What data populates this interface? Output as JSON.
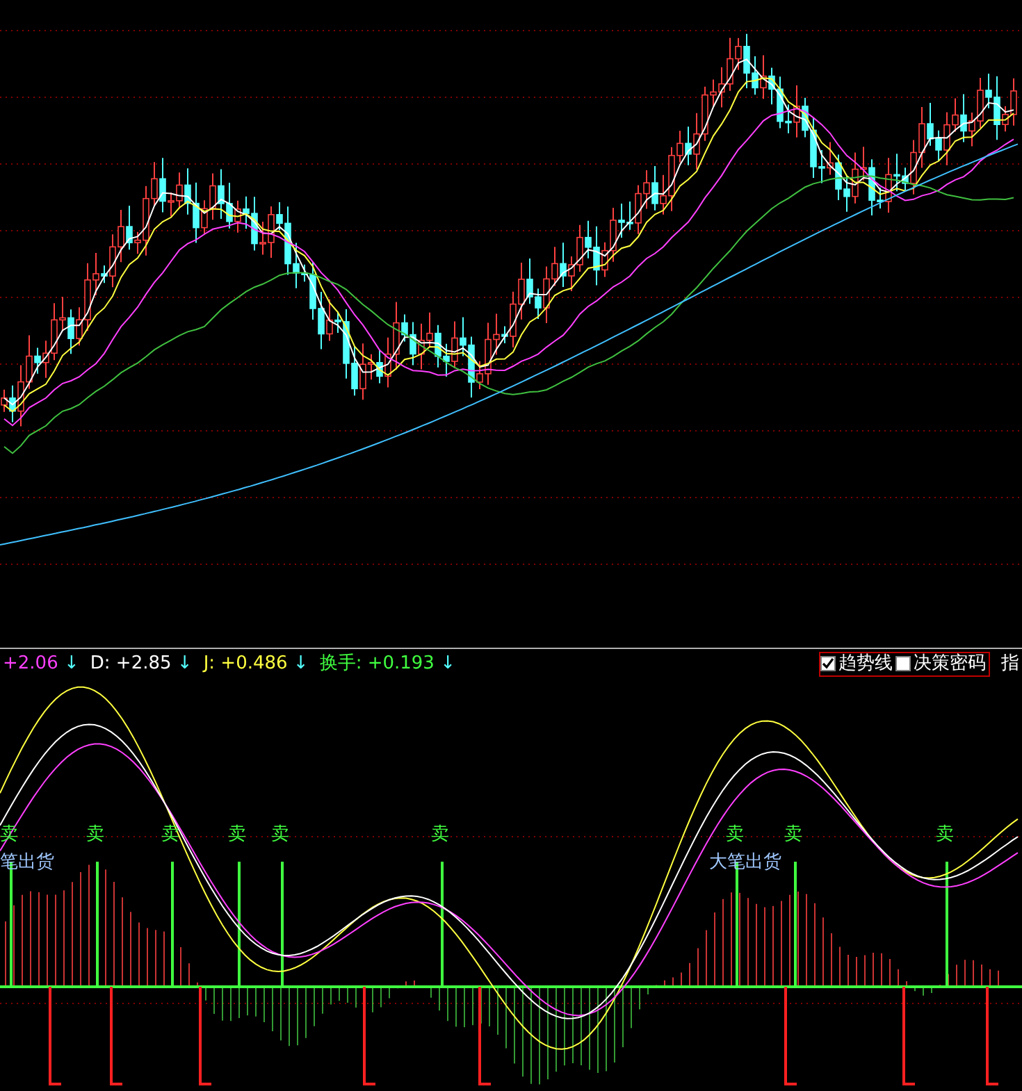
{
  "indicator_bar": {
    "values": [
      {
        "kind": "k",
        "text": "+2.06",
        "arrow": "↓"
      },
      {
        "kind": "d",
        "label": "D:",
        "text": "+2.85",
        "arrow": "↓"
      },
      {
        "kind": "j",
        "label": "J:",
        "text": "+0.486",
        "arrow": "↓"
      },
      {
        "kind": "turnover",
        "label": "换手:",
        "text": "+0.193",
        "arrow": "↓"
      }
    ],
    "options": [
      {
        "label": "趋势线",
        "checked": true
      },
      {
        "label": "决策密码",
        "checked": false
      }
    ],
    "cut_label": "指"
  },
  "signals": [
    {
      "kind": "sell",
      "text": "卖"
    },
    {
      "kind": "sell",
      "text": "卖"
    },
    {
      "kind": "sell",
      "text": "卖"
    },
    {
      "kind": "sell",
      "text": "卖"
    },
    {
      "kind": "sell",
      "text": "卖"
    },
    {
      "kind": "sell",
      "text": "卖"
    },
    {
      "kind": "sell",
      "text": "卖"
    },
    {
      "kind": "sell",
      "text": "卖"
    },
    {
      "kind": "sell",
      "text": "卖"
    },
    {
      "kind": "block",
      "text": "笔出货"
    },
    {
      "kind": "block",
      "text": "大笔出货"
    }
  ]
}
